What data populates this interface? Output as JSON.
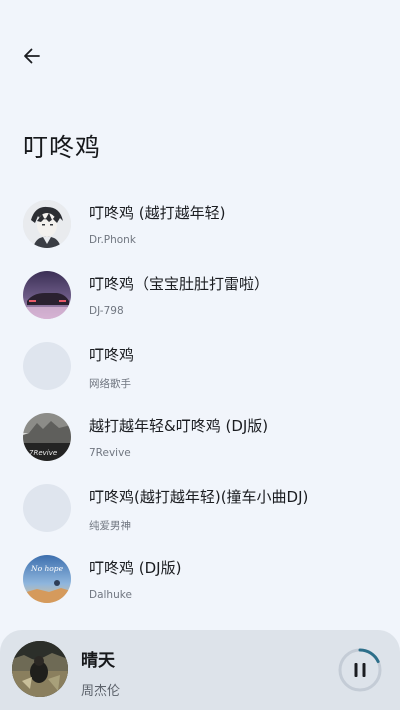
{
  "header": {
    "back_icon": "arrow-left-icon",
    "title": "叮咚鸡"
  },
  "songs": [
    {
      "title": "叮咚鸡 (越打越年轻)",
      "artist": "Dr.Phonk",
      "cover": "anime-character-art"
    },
    {
      "title": "叮咚鸡（宝宝肚肚打雷啦）",
      "artist": "DJ-798",
      "cover": "car-night-art"
    },
    {
      "title": "叮咚鸡",
      "artist": "网络歌手",
      "cover": "placeholder"
    },
    {
      "title": "越打越年轻&叮咚鸡 (DJ版)",
      "artist": "7Revive",
      "cover": "7revive-art",
      "cover_text": "7Revive"
    },
    {
      "title": "叮咚鸡(越打越年轻)(撞车小曲DJ)",
      "artist": "纯爱男神",
      "cover": "placeholder"
    },
    {
      "title": "叮咚鸡 (DJ版)",
      "artist": "Dalhuke",
      "cover": "no-hope-art",
      "cover_text": "No hope"
    }
  ],
  "now_playing": {
    "title": "晴天",
    "artist": "周杰伦",
    "control_icon": "pause-icon",
    "progress": 0.18,
    "colors": {
      "track": "#c4ccd6",
      "progress": "#2d6f8a",
      "icon": "#1b1d21"
    }
  },
  "colors": {
    "background": "#f1f5fb",
    "placeholder": "#dfe5ee",
    "bar": "#dde3ea"
  }
}
